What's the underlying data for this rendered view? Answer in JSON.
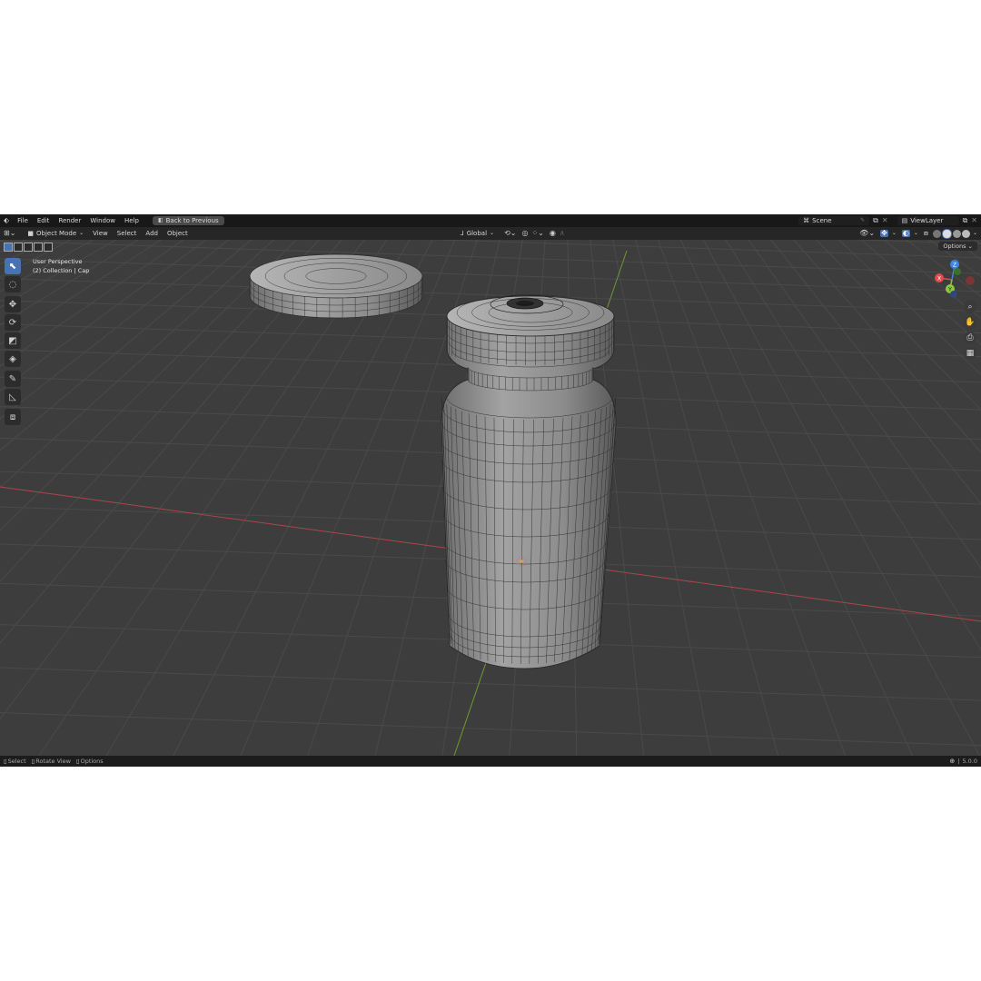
{
  "menu": {
    "items": [
      "File",
      "Edit",
      "Render",
      "Window",
      "Help"
    ],
    "back_button": "Back to Previous"
  },
  "topbar_right": {
    "scene": "Scene",
    "view_layer": "ViewLayer"
  },
  "header": {
    "mode": "Object Mode",
    "menus": [
      "View",
      "Select",
      "Add",
      "Object"
    ],
    "orientation": "Global",
    "options": "Options"
  },
  "viewport": {
    "perspective": "User Perspective",
    "collection": "(2) Collection | Cap"
  },
  "gizmo": {
    "x": "X",
    "y": "Y",
    "z": "Z"
  },
  "status": {
    "select": "Select",
    "rotate": "Rotate View",
    "options": "Options",
    "version": "5.0.0"
  },
  "colors": {
    "accent": "#4772b3",
    "x_axis": "#e04b4b",
    "y_axis": "#8cc83c",
    "z_axis": "#3d86e0",
    "grid_bg": "#3d3d3d",
    "mesh": "#9a9a9a"
  }
}
